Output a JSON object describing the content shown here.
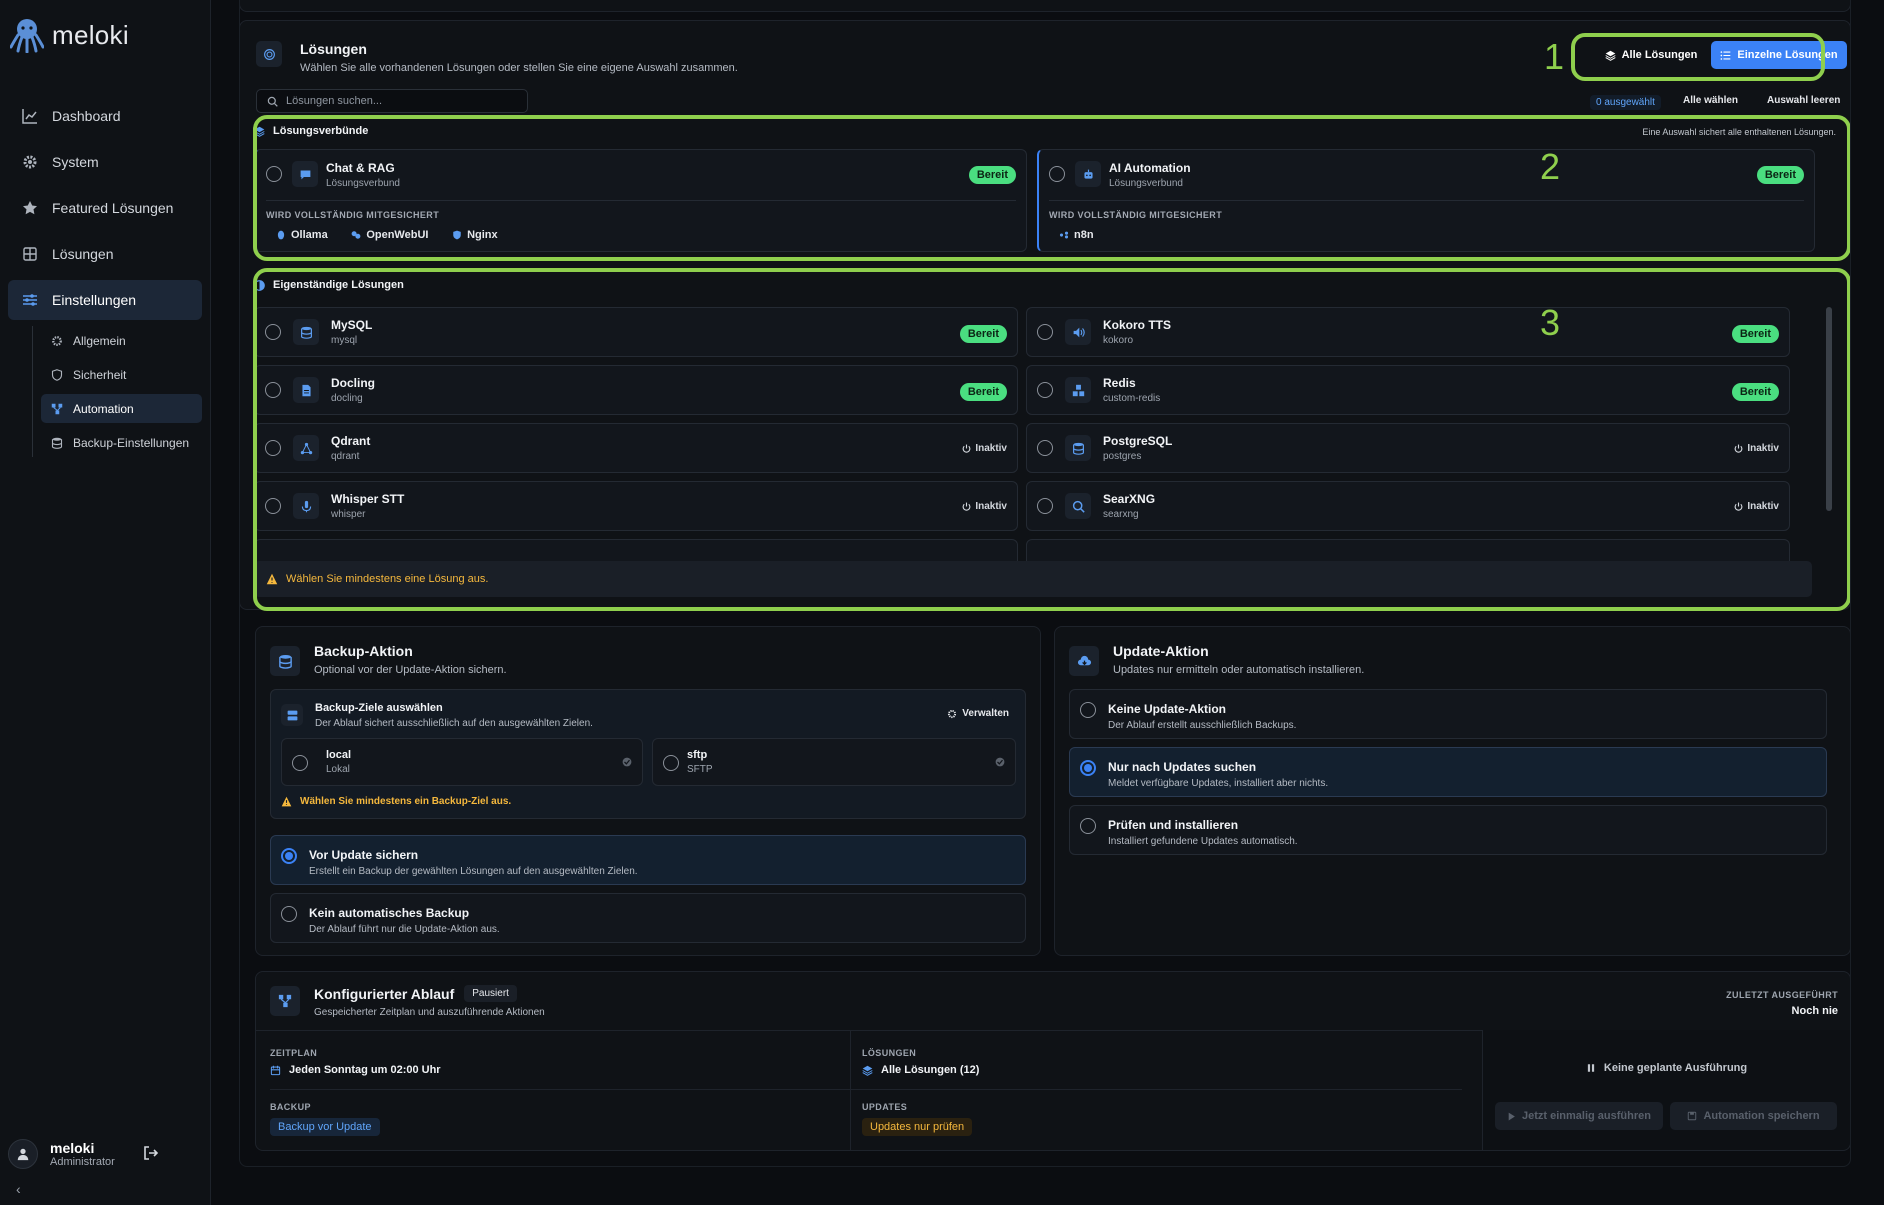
{
  "brand": {
    "name": "meloki",
    "accent": "#3b82f6",
    "highlight": "#8fcf4d"
  },
  "sidebar": {
    "items": [
      {
        "label": "Dashboard",
        "icon": "chart-line-icon"
      },
      {
        "label": "System",
        "icon": "gear-icon"
      },
      {
        "label": "Featured Lösungen",
        "icon": "star-icon"
      },
      {
        "label": "Lösungen",
        "icon": "grid-icon"
      },
      {
        "label": "Einstellungen",
        "icon": "sliders-icon"
      }
    ],
    "sub_items": [
      {
        "label": "Allgemein",
        "icon": "gear-icon"
      },
      {
        "label": "Sicherheit",
        "icon": "shield-icon"
      },
      {
        "label": "Automation",
        "icon": "workflow-icon"
      },
      {
        "label": "Backup-Einstellungen",
        "icon": "database-icon"
      }
    ],
    "user": {
      "name": "meloki",
      "role": "Administrator"
    },
    "collapse_glyph": "‹"
  },
  "solutions": {
    "title": "Lösungen",
    "subtitle": "Wählen Sie alle vorhandenen Lösungen oder stellen Sie eine eigene Auswahl zusammen.",
    "btn_all": "Alle Lösungen",
    "btn_single": "Einzelne Lösungen",
    "search_placeholder": "Lösungen suchen...",
    "selected_count": "0 ausgewählt",
    "select_all": "Alle wählen",
    "clear": "Auswahl leeren",
    "annotations": [
      "1",
      "2",
      "3"
    ],
    "bundles": {
      "title": "Lösungsverbünde",
      "hint": "Eine Auswahl sichert alle enthaltenen Lösungen.",
      "section_label": "WIRD VOLLSTÄNDIG MITGESICHERT",
      "items": [
        {
          "name": "Chat & RAG",
          "sub": "Lösungsverbund",
          "status": "Bereit",
          "includes": [
            "Ollama",
            "OpenWebUI",
            "Nginx"
          ]
        },
        {
          "name": "AI Automation",
          "sub": "Lösungsverbund",
          "status": "Bereit",
          "includes": [
            "n8n"
          ]
        }
      ]
    },
    "standalone": {
      "title": "Eigenständige Lösungen",
      "items": [
        {
          "name": "MySQL",
          "sub": "mysql",
          "status": "Bereit",
          "icon": "database-icon"
        },
        {
          "name": "Kokoro TTS",
          "sub": "kokoro",
          "status": "Bereit",
          "icon": "speaker-icon"
        },
        {
          "name": "Docling",
          "sub": "docling",
          "status": "Bereit",
          "icon": "document-icon"
        },
        {
          "name": "Redis",
          "sub": "custom-redis",
          "status": "Bereit",
          "icon": "cubes-icon"
        },
        {
          "name": "Qdrant",
          "sub": "qdrant",
          "status": "Inaktiv",
          "icon": "nodes-icon"
        },
        {
          "name": "PostgreSQL",
          "sub": "postgres",
          "status": "Inaktiv",
          "icon": "database-icon"
        },
        {
          "name": "Whisper STT",
          "sub": "whisper",
          "status": "Inaktiv",
          "icon": "microphone-icon"
        },
        {
          "name": "SearXNG",
          "sub": "searxng",
          "status": "Inaktiv",
          "icon": "search-icon"
        }
      ],
      "warning": "Wählen Sie mindestens eine Lösung aus."
    }
  },
  "backup": {
    "title": "Backup-Aktion",
    "subtitle": "Optional vor der Update-Aktion sichern.",
    "targets": {
      "title": "Backup-Ziele auswählen",
      "subtitle": "Der Ablauf sichert ausschließlich auf den ausgewählten Zielen.",
      "manage": "Verwalten",
      "items": [
        {
          "name": "local",
          "sub": "Lokal"
        },
        {
          "name": "sftp",
          "sub": "SFTP"
        }
      ],
      "warning": "Wählen Sie mindestens ein Backup-Ziel aus."
    },
    "options": [
      {
        "title": "Vor Update sichern",
        "desc": "Erstellt ein Backup der gewählten Lösungen auf den ausgewählten Zielen.",
        "selected": true
      },
      {
        "title": "Kein automatisches Backup",
        "desc": "Der Ablauf führt nur die Update-Aktion aus.",
        "selected": false
      }
    ]
  },
  "update": {
    "title": "Update-Aktion",
    "subtitle": "Updates nur ermitteln oder automatisch installieren.",
    "options": [
      {
        "title": "Keine Update-Aktion",
        "desc": "Der Ablauf erstellt ausschließlich Backups.",
        "selected": false
      },
      {
        "title": "Nur nach Updates suchen",
        "desc": "Meldet verfügbare Updates, installiert aber nichts.",
        "selected": true
      },
      {
        "title": "Prüfen und installieren",
        "desc": "Installiert gefundene Updates automatisch.",
        "selected": false
      }
    ]
  },
  "flow": {
    "title": "Konfigurierter Ablauf",
    "status": "Pausiert",
    "subtitle": "Gespeicherter Zeitplan und auszuführende Aktionen",
    "last_run_label": "ZULETZT AUSGEFÜHRT",
    "last_run_value": "Noch nie",
    "schedule_label": "ZEITPLAN",
    "schedule_value": "Jeden Sonntag um 02:00 Uhr",
    "solutions_label": "LÖSUNGEN",
    "solutions_value": "Alle Lösungen (12)",
    "backup_label": "BACKUP",
    "backup_value": "Backup vor Update",
    "updates_label": "UPDATES",
    "updates_value": "Updates nur prüfen",
    "no_schedule": "Keine geplante Ausführung",
    "run_once": "Jetzt einmalig ausführen",
    "save": "Automation speichern"
  }
}
